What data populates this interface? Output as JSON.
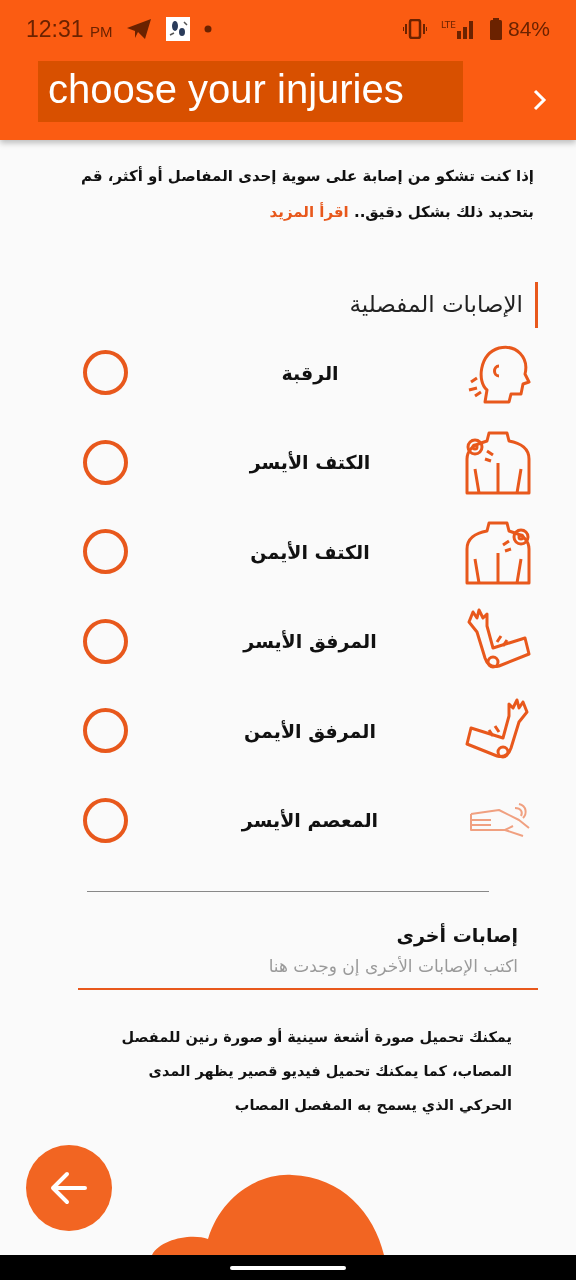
{
  "status_bar": {
    "time": "12:31",
    "time_suffix": "PM",
    "network_type": "LTE",
    "battery": "84%"
  },
  "header": {
    "title": "choose your injuries"
  },
  "intro": {
    "text": "إذا كنت تشكو من إصابة على سوية إحدى المفاصل أو أكثر، قم بتحديد ذلك بشكل دقيق..",
    "link": "اقرأ المزيد"
  },
  "section_title": "الإصابات المفصلية",
  "joints": [
    {
      "label": "الرقبة",
      "kind": "neck",
      "selected": false
    },
    {
      "label": "الكتف الأيسر",
      "kind": "shoulder_left",
      "selected": false
    },
    {
      "label": "الكتف الأيمن",
      "kind": "shoulder_right",
      "selected": false
    },
    {
      "label": "المرفق الأيسر",
      "kind": "elbow_left",
      "selected": false
    },
    {
      "label": "المرفق الأيمن",
      "kind": "elbow_right",
      "selected": false
    },
    {
      "label": "المعصم الأيسر",
      "kind": "wrist",
      "selected": false
    }
  ],
  "other_injuries": {
    "label": "إصابات أخرى",
    "placeholder": "اكتب الإصابات الأخرى إن وجدت هنا"
  },
  "upload_note": "يمكنك تحميل صورة أشعة سينية أو صورة رنين للمفصل المصاب، كما يمكنك تحميل فيديو قصير يظهر المدى الحركي الذي يسمح به المفصل المصاب"
}
